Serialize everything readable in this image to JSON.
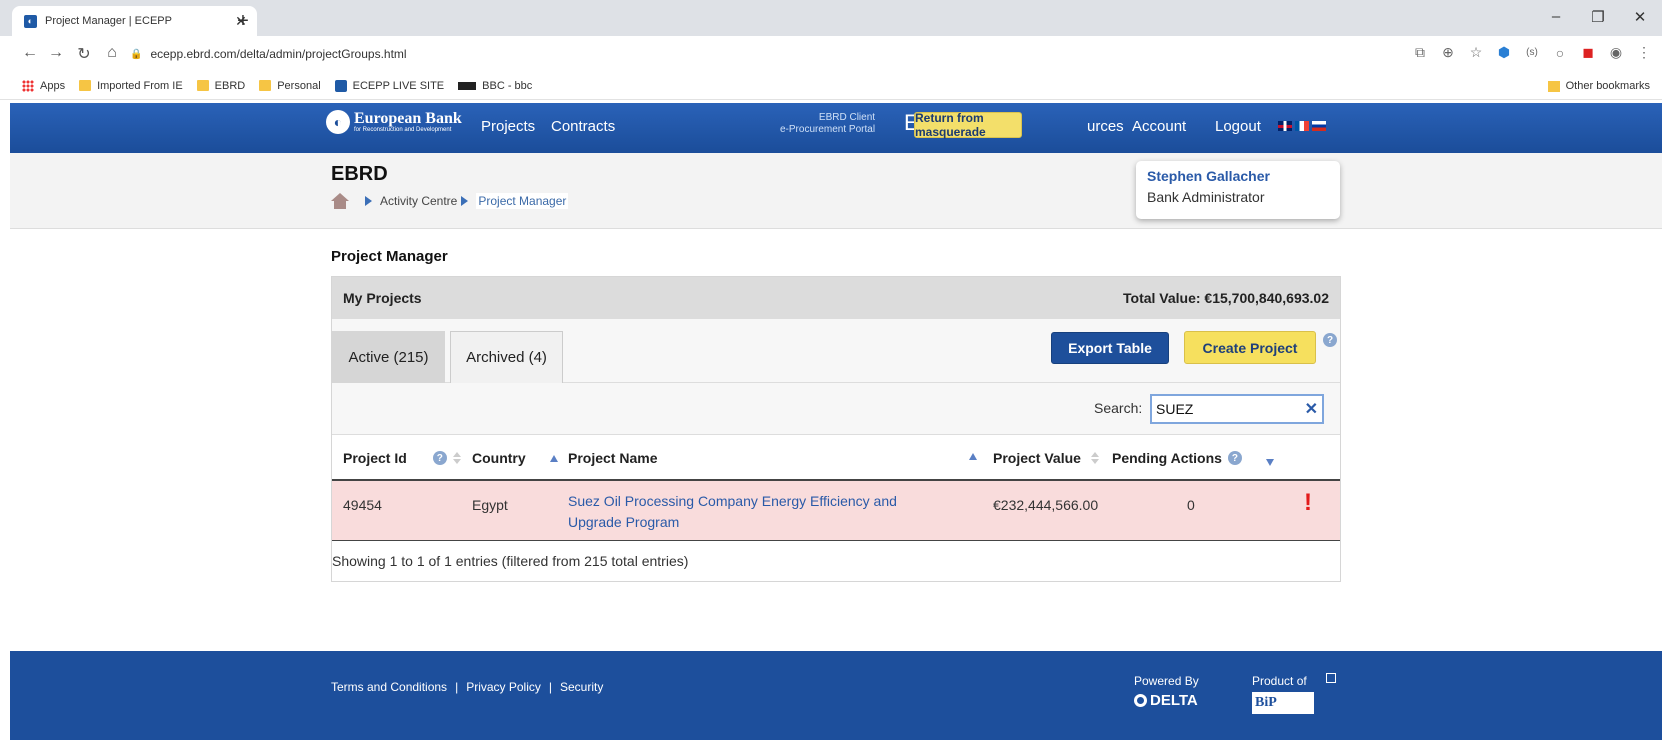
{
  "browser": {
    "tab_title": "Project Manager | ECEPP",
    "url": "ecepp.ebrd.com/delta/admin/projectGroups.html",
    "bookmarks": [
      "Apps",
      "Imported From IE",
      "EBRD",
      "Personal",
      "ECEPP LIVE SITE",
      "BBC - bbc"
    ],
    "other_bookmarks": "Other bookmarks"
  },
  "site": {
    "logo_name": "European Bank",
    "logo_sub": "for Reconstruction and Development",
    "nav": {
      "projects": "Projects",
      "contracts": "Contracts",
      "resources_partial": "urces",
      "account": "Account",
      "logout": "Logout"
    },
    "portal_line1": "EBRD Client",
    "portal_line2": "e-Procurement Portal",
    "portal_letter": "E",
    "masquerade_button": "Return from masquerade"
  },
  "subheader": {
    "org": "EBRD",
    "breadcrumb": [
      "Activity Centre",
      "Project Manager"
    ]
  },
  "user": {
    "name": "Stephen Gallacher",
    "role": "Bank Administrator"
  },
  "main": {
    "page_title": "Project Manager",
    "panel_title": "My Projects",
    "total_value": "Total Value: €15,700,840,693.02",
    "tabs": [
      {
        "label": "Active (215)",
        "active": true
      },
      {
        "label": "Archived (4)",
        "active": false
      }
    ],
    "export_button": "Export Table",
    "create_button": "Create Project",
    "search_label": "Search:",
    "search_value": "SUEZ",
    "columns": {
      "project_id": "Project Id",
      "country": "Country",
      "project_name": "Project Name",
      "project_value": "Project Value",
      "pending_actions": "Pending Actions"
    },
    "rows": [
      {
        "project_id": "49454",
        "country": "Egypt",
        "project_name": "Suez Oil Processing Company Energy Efficiency and Upgrade Program",
        "project_value": "€232,444,566.00",
        "pending_actions": "0",
        "alert": "!"
      }
    ],
    "table_info": "Showing 1 to 1 of 1 entries (filtered from 215 total entries)"
  },
  "footer": {
    "terms": "Terms and Conditions",
    "privacy": "Privacy Policy",
    "security": "Security",
    "separator": "|",
    "powered_by": "Powered By",
    "delta": "DELTA",
    "product_of": "Product of",
    "bip": "BiP"
  },
  "colors": {
    "header_blue": "#1b4d9a",
    "accent_yellow": "#f6e05e",
    "row_highlight": "#f9dcdc",
    "alert_red": "#e31b1b"
  }
}
